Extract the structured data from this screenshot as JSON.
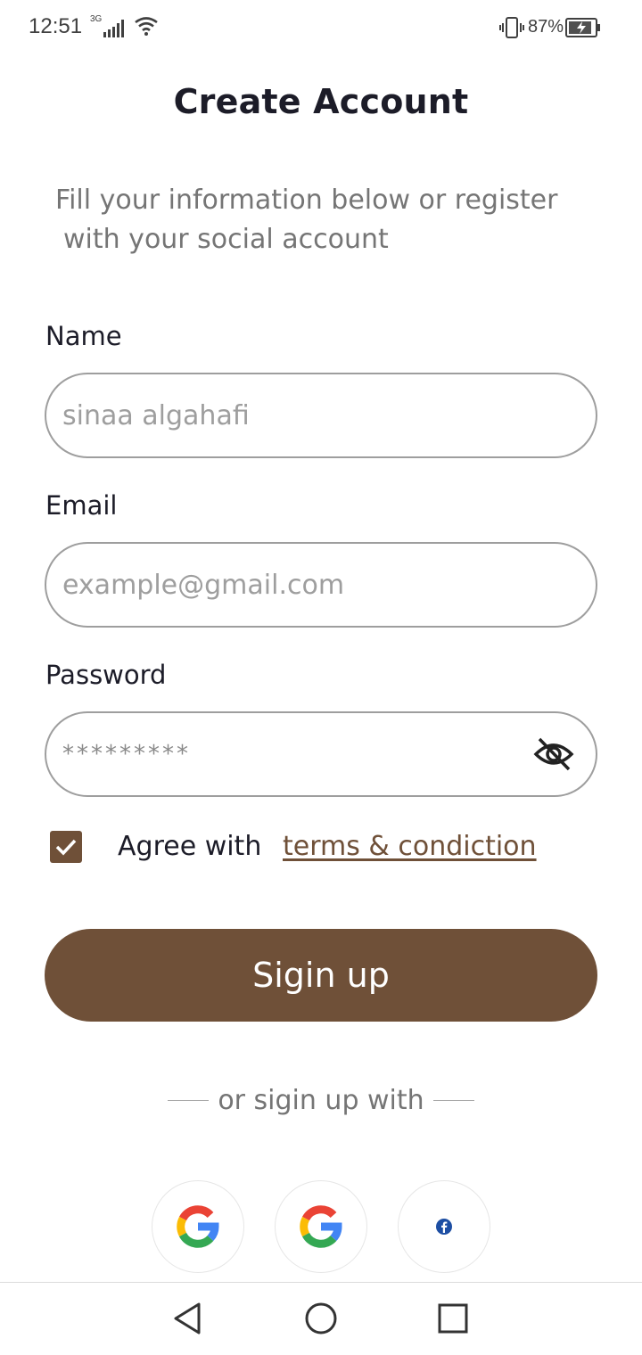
{
  "status_bar": {
    "time": "12:51",
    "network": "3G",
    "battery_percent": "87%",
    "icons": [
      "signal-icon",
      "wifi-icon",
      "vibrate-icon",
      "battery-charging-icon"
    ]
  },
  "header": {
    "title": "Create Account",
    "subtitle_line1": "Fill your information below or register",
    "subtitle_line2": "with your social account"
  },
  "form": {
    "name": {
      "label": "Name",
      "placeholder": "sinaa algahafi"
    },
    "email": {
      "label": "Email",
      "placeholder": "example@gmail.com"
    },
    "password": {
      "label": "Password",
      "value": "*********",
      "toggle_icon": "eye-off-icon"
    },
    "agree": {
      "checked": true,
      "text": "Agree with",
      "link": "terms & condiction"
    },
    "submit_label": "Sigin up"
  },
  "social": {
    "divider_text": "or sigin up with",
    "providers": [
      "google-icon",
      "google-icon",
      "facebook-icon"
    ]
  },
  "nav": {
    "icons": [
      "back-icon",
      "home-icon",
      "recents-icon"
    ]
  },
  "colors": {
    "accent": "#6f5038",
    "border": "#9e9e9e",
    "muted_text": "#757575"
  }
}
